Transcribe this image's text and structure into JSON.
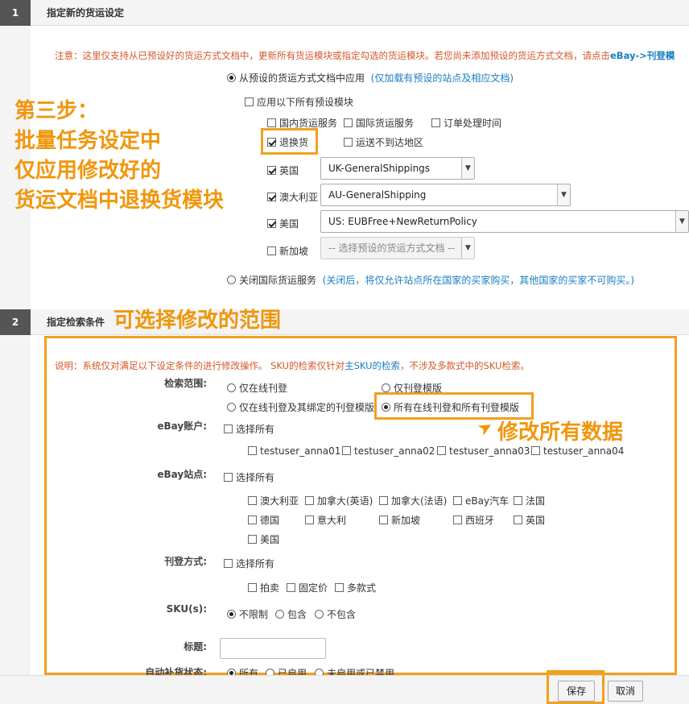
{
  "section1": {
    "number": "1",
    "title": "指定新的货运设定",
    "notice": "注意：这里仅支持从已预设好的货运方式文档中，更新所有货运模块或指定勾选的货运模块。若您尚未添加预设的货运方式文档，请点击",
    "notice_link": "eBay->刊登模",
    "apply_from_preset": "从预设的货运方式文档中应用",
    "apply_from_preset_note": "(仅加载有预设的站点及相应文档)",
    "apply_all_modules": "应用以下所有预设模块",
    "modules": {
      "domestic": "国内货运服务",
      "international": "国际货运服务",
      "handling_time": "订单处理时间",
      "returns": "退换货",
      "exclude_locations": "运送不到达地区"
    },
    "sites": [
      {
        "name": "英国",
        "checked": true,
        "value": "UK-GeneralShippings",
        "disabled": false
      },
      {
        "name": "澳大利亚",
        "checked": true,
        "value": "AU-GeneralShipping",
        "disabled": false
      },
      {
        "name": "美国",
        "checked": true,
        "value": "US: EUBFree+NewReturnPolicy",
        "disabled": false
      },
      {
        "name": "新加坡",
        "checked": false,
        "value": "-- 选择预设的货运方式文档 --",
        "disabled": true
      }
    ],
    "close_intl": "关闭国际货运服务",
    "close_intl_note": "(关闭后，将仅允许站点所在国家的买家购买，其他国家的买家不可购买。)"
  },
  "section2": {
    "number": "2",
    "title": "指定检索条件",
    "notice_prefix": "说明：系统仅对满足以下设定条件的进行修改操作。 SKU的检索仅针对",
    "notice_highlight": "主SKU的检索",
    "notice_suffix": "，不涉及多款式中的SKU检索。",
    "search_scope_label": "检索范围:",
    "scope_options": [
      "仅在线刊登",
      "仅刊登模版",
      "仅在线刊登及其绑定的刊登模版",
      "所有在线刊登和所有刊登模版"
    ],
    "ebay_account_label": "eBay账户:",
    "select_all": "选择所有",
    "accounts": [
      "testuser_anna01",
      "testuser_anna02",
      "testuser_anna03",
      "testuser_anna04"
    ],
    "ebay_site_label": "eBay站点:",
    "site_list": [
      "澳大利亚",
      "加拿大(英语)",
      "加拿大(法语)",
      "eBay汽车",
      "法国",
      "德国",
      "意大利",
      "新加坡",
      "西班牙",
      "英国",
      "美国"
    ],
    "listing_type_label": "刊登方式:",
    "listing_types": [
      "拍卖",
      "固定价",
      "多款式"
    ],
    "sku_label": "SKU(s):",
    "sku_options": [
      "不限制",
      "包含",
      "不包含"
    ],
    "title_label": "标题:",
    "title_value": "",
    "restock_label": "自动补货状态:",
    "restock_options": [
      "所有",
      "已启用",
      "未启用或已禁用"
    ]
  },
  "annotations": {
    "step3_lines": [
      "第三步：",
      "批量任务设定中",
      "仅应用修改好的",
      "货运文档中退换货模块"
    ],
    "range_note": "可选择修改的范围",
    "modify_all": "修改所有数据"
  },
  "footer": {
    "save": "保存",
    "cancel": "取消"
  },
  "colors": {
    "annotation": "#f0960c",
    "notice": "#d4572a",
    "link": "#1a7ec2"
  }
}
